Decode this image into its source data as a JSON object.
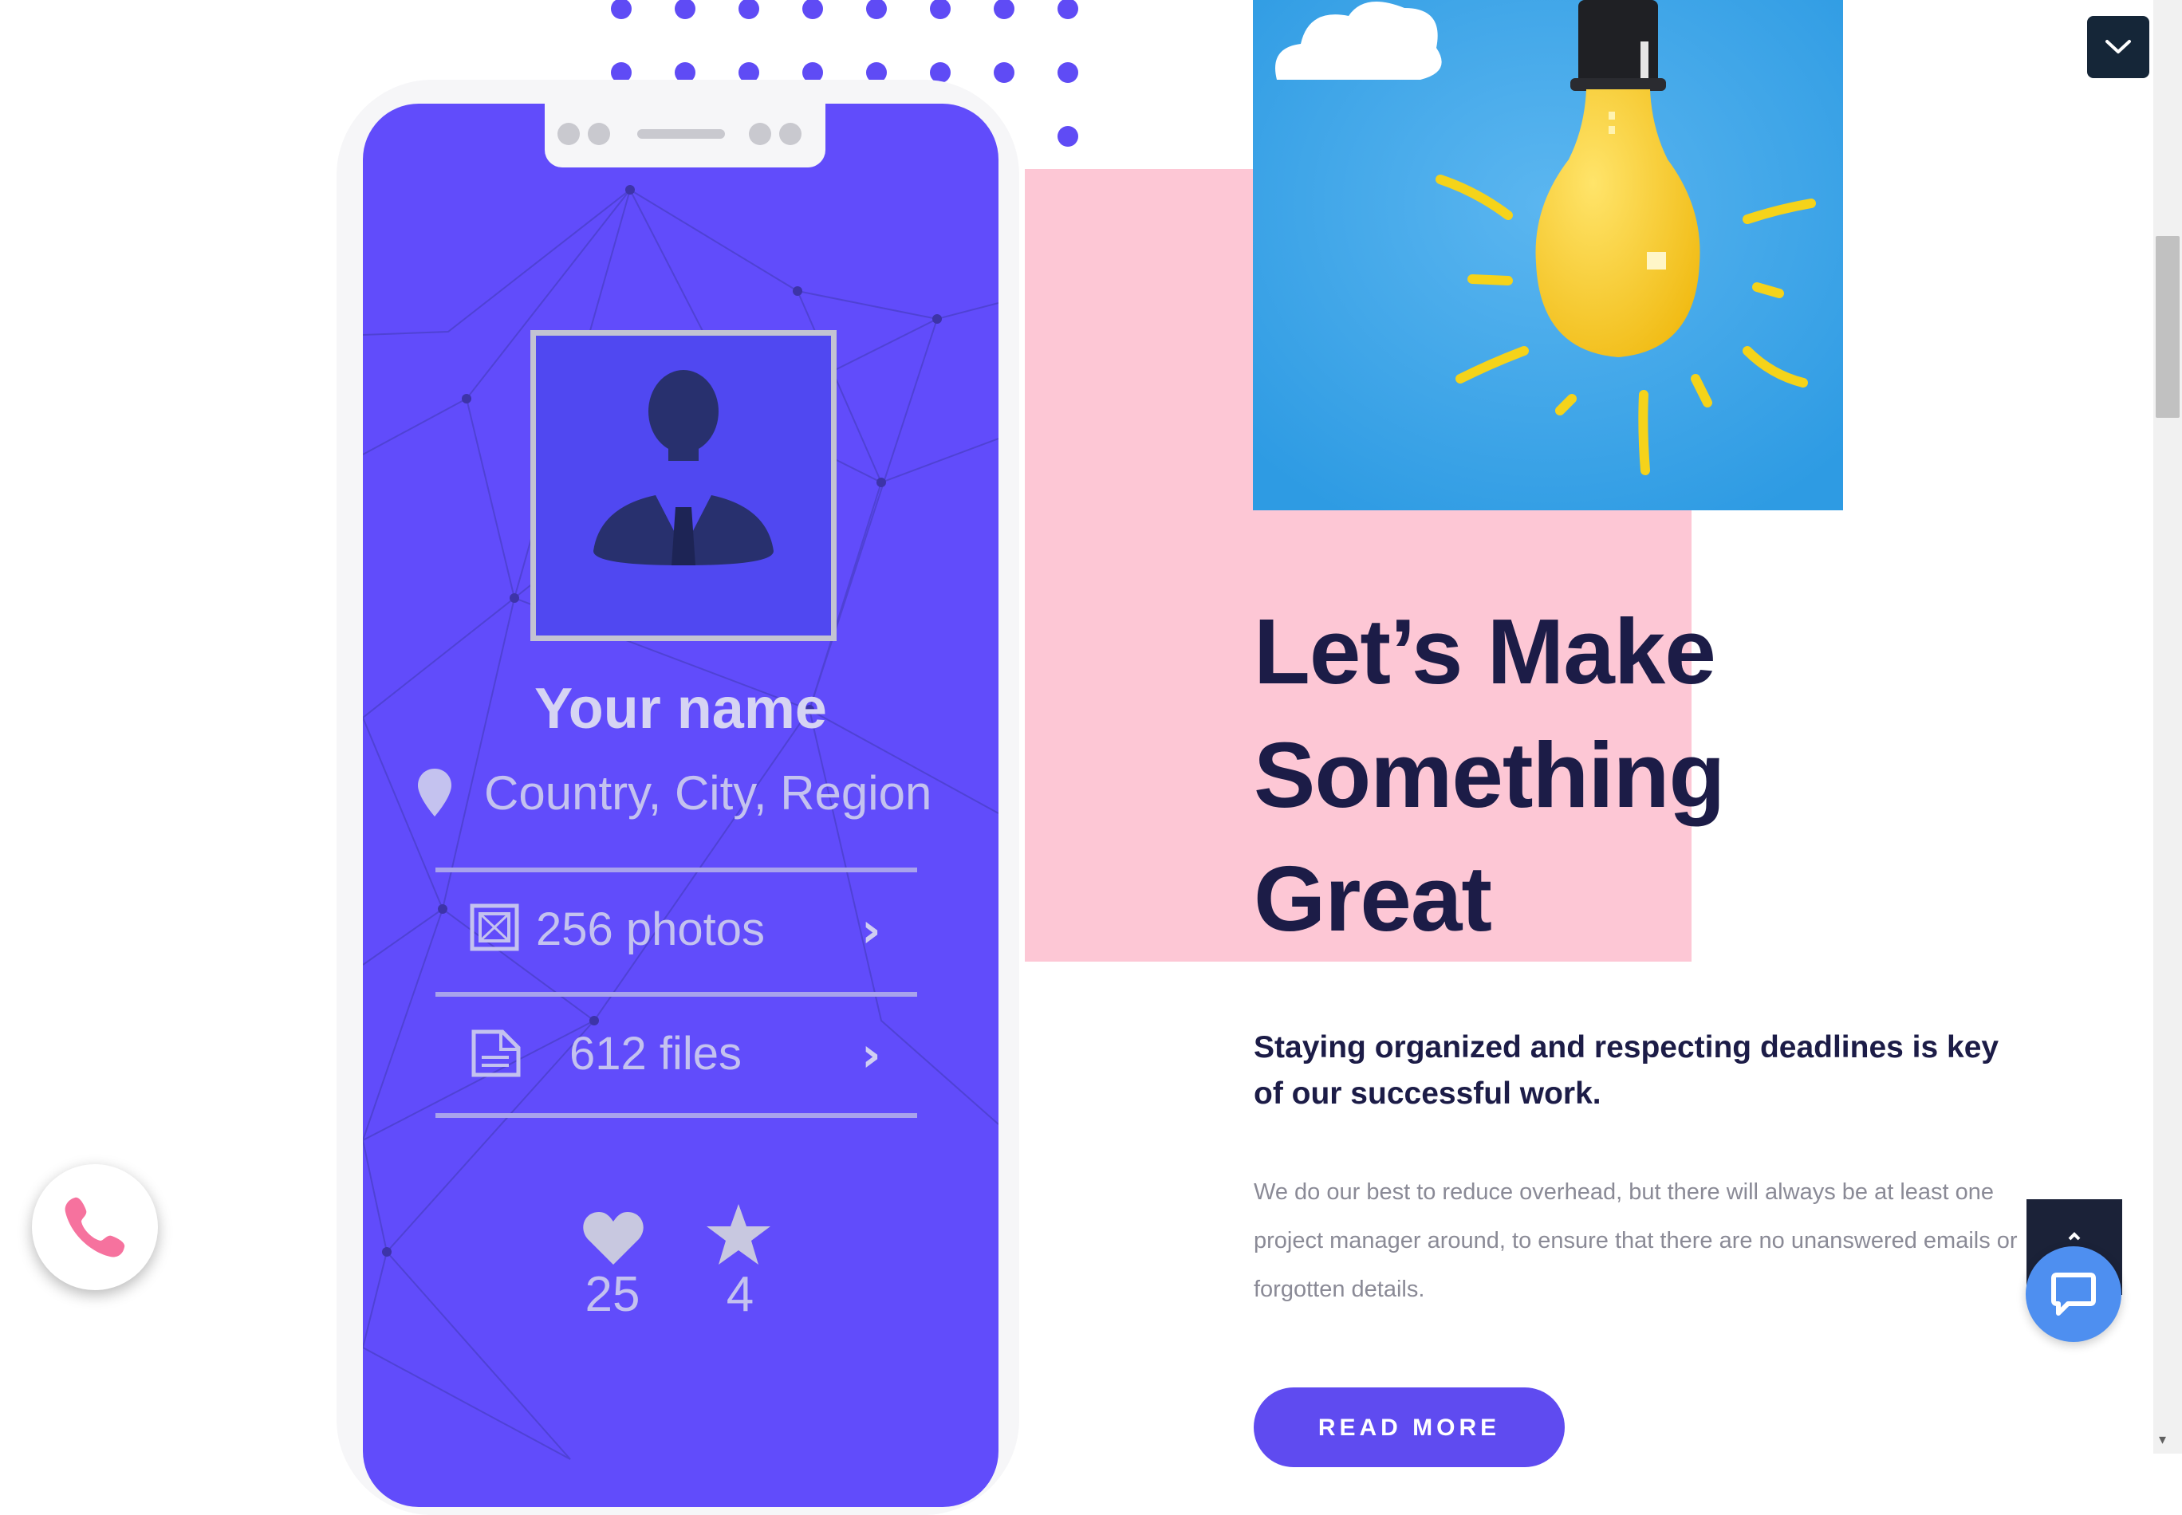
{
  "profile_card": {
    "name": "Your name",
    "location": "Country, City, Region",
    "photos_label": "256 photos",
    "files_label": "612 files",
    "likes_count": "25",
    "stars_count": "4"
  },
  "content": {
    "headline_line1": "Let’s Make",
    "headline_line2": "Something",
    "headline_line3": "Great",
    "subheading": "Staying organized and respecting deadlines is key of our successful work.",
    "paragraph": "We do our best to reduce overhead, but there will always be at least one project manager around, to ensure that there are no unanswered emails or forgotten details.",
    "read_more_label": "READ MORE"
  },
  "colors": {
    "accent_purple": "#5f4bf0",
    "pink_block": "#fdc7d5",
    "navy_text": "#1c1c47",
    "sky_blue": "#44a8ea",
    "chat_blue": "#4e8ff0",
    "phone_pink": "#f6729e"
  },
  "icons": {
    "header_toggle": "chevron-down-icon",
    "call": "phone-icon",
    "chat": "chat-bubble-icon",
    "back_to_top": "arrow-up-icon"
  }
}
